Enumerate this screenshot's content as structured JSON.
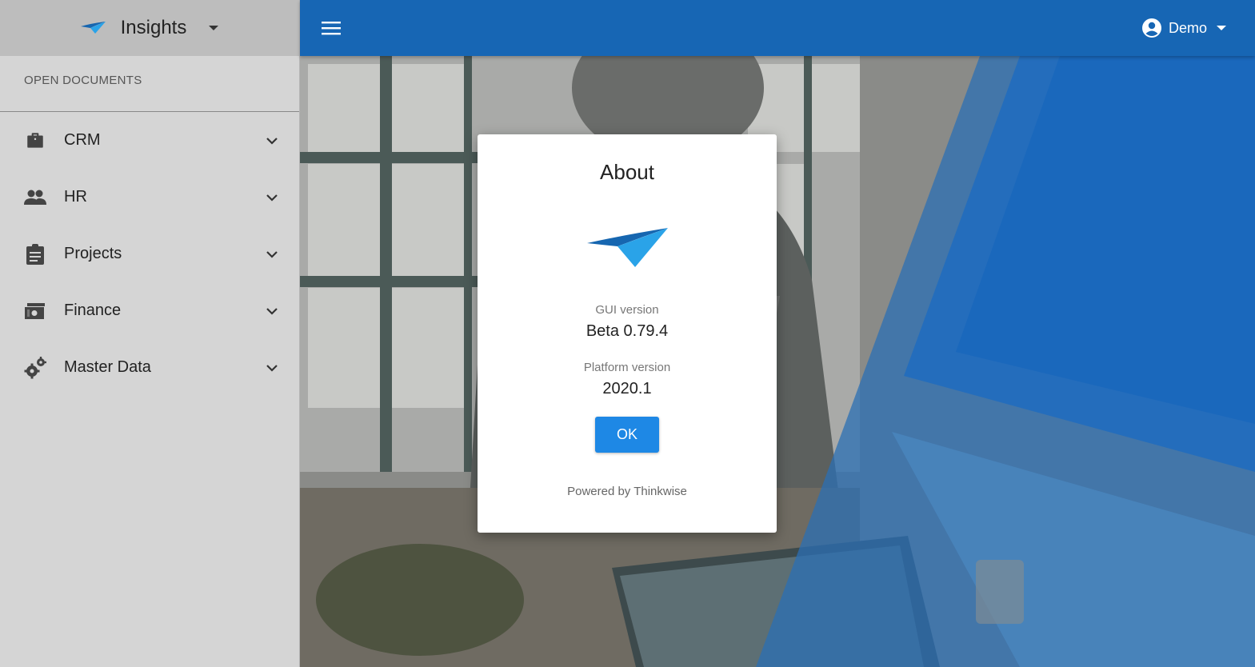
{
  "app": {
    "name": "Insights"
  },
  "sidebar": {
    "section_label": "OPEN DOCUMENTS",
    "items": [
      {
        "label": "CRM",
        "icon": "briefcase-icon"
      },
      {
        "label": "HR",
        "icon": "people-icon"
      },
      {
        "label": "Projects",
        "icon": "clipboard-icon"
      },
      {
        "label": "Finance",
        "icon": "money-icon"
      },
      {
        "label": "Master Data",
        "icon": "gears-icon"
      }
    ]
  },
  "topbar": {
    "user_name": "Demo"
  },
  "about_dialog": {
    "title": "About",
    "gui_version_label": "GUI version",
    "gui_version": "Beta 0.79.4",
    "platform_version_label": "Platform version",
    "platform_version": "2020.1",
    "ok_label": "OK",
    "powered_by": "Powered by Thinkwise"
  },
  "colors": {
    "topbar": "#1766b4",
    "sidebar": "#d5d5d5",
    "sidebar_header": "#bdbdbd",
    "button": "#1e88e5",
    "logo_dark": "#1666b0",
    "logo_light": "#2aa3e8"
  }
}
